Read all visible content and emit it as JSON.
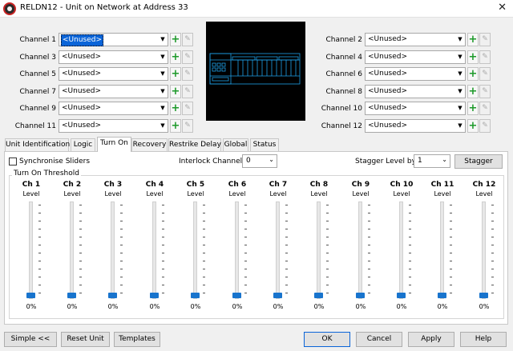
{
  "window": {
    "title": "RELDN12 - Unit on Network at Address 33",
    "close_glyph": "✕"
  },
  "channels_left": [
    {
      "label": "Channel 1",
      "value": "<Unused>"
    },
    {
      "label": "Channel 3",
      "value": "<Unused>"
    },
    {
      "label": "Channel 5",
      "value": "<Unused>"
    },
    {
      "label": "Channel 7",
      "value": "<Unused>"
    },
    {
      "label": "Channel 9",
      "value": "<Unused>"
    },
    {
      "label": "Channel 11",
      "value": "<Unused>"
    }
  ],
  "channels_right": [
    {
      "label": "Channel 2",
      "value": "<Unused>"
    },
    {
      "label": "Channel 4",
      "value": "<Unused>"
    },
    {
      "label": "Channel 6",
      "value": "<Unused>"
    },
    {
      "label": "Channel 8",
      "value": "<Unused>"
    },
    {
      "label": "Channel 10",
      "value": "<Unused>"
    },
    {
      "label": "Channel 12",
      "value": "<Unused>"
    }
  ],
  "channel_controls": {
    "add_glyph": "+",
    "edit_glyph": "✎",
    "arrow_glyph": "▼"
  },
  "tabs": [
    {
      "label": "Unit Identification",
      "active": false
    },
    {
      "label": "Logic",
      "active": false
    },
    {
      "label": "Turn On",
      "active": true
    },
    {
      "label": "Recovery",
      "active": false
    },
    {
      "label": "Restrike Delay",
      "active": false
    },
    {
      "label": "Global",
      "active": false
    },
    {
      "label": "Status",
      "active": false
    }
  ],
  "turn_on": {
    "sync_label": "Synchronise Sliders",
    "sync_checked": false,
    "interlock_label": "Interlock Channels",
    "interlock_value": "0",
    "stagger_level_label": "Stagger Level by",
    "stagger_level_value": "1",
    "stagger_button": "Stagger",
    "group_title": "Turn On Threshold",
    "level_label": "Level",
    "sliders": [
      {
        "name": "Ch 1",
        "percent": "0%",
        "value": 0
      },
      {
        "name": "Ch 2",
        "percent": "0%",
        "value": 0
      },
      {
        "name": "Ch 3",
        "percent": "0%",
        "value": 0
      },
      {
        "name": "Ch 4",
        "percent": "0%",
        "value": 0
      },
      {
        "name": "Ch 5",
        "percent": "0%",
        "value": 0
      },
      {
        "name": "Ch 6",
        "percent": "0%",
        "value": 0
      },
      {
        "name": "Ch 7",
        "percent": "0%",
        "value": 0
      },
      {
        "name": "Ch 8",
        "percent": "0%",
        "value": 0
      },
      {
        "name": "Ch 9",
        "percent": "0%",
        "value": 0
      },
      {
        "name": "Ch 10",
        "percent": "0%",
        "value": 0
      },
      {
        "name": "Ch 11",
        "percent": "0%",
        "value": 0
      },
      {
        "name": "Ch 12",
        "percent": "0%",
        "value": 0
      }
    ]
  },
  "footer": {
    "simple": "Simple <<",
    "reset_unit": "Reset Unit",
    "templates": "Templates",
    "ok": "OK",
    "cancel": "Cancel",
    "apply": "Apply",
    "help": "Help"
  },
  "colors": {
    "accent": "#0a64d8",
    "slider_thumb": "#1874cd",
    "add_green": "#1d9a2a",
    "preview_line": "#1ea0e8"
  }
}
